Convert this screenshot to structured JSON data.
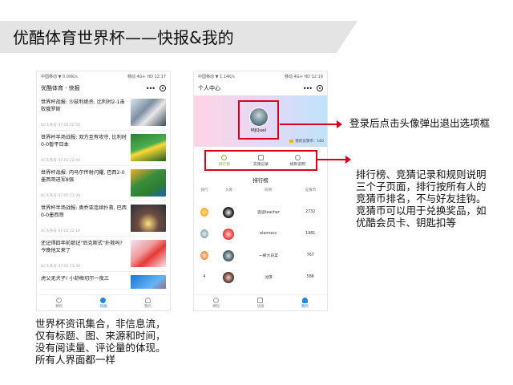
{
  "slide_title": "优酷体育世界杯——快报&我的",
  "news_phone": {
    "status_left": "中国移动 ▼  0.00K/s",
    "status_right": "移动 4G+ HD  12:17",
    "nav_title": "优酷体育 · 快报",
    "more_icon": "more-dots-icon",
    "target_icon": "target-circle-icon",
    "items": [
      {
        "title": "世界杯战报: 沙兹利绝杀, 比利时2-1击败俄罗斯",
        "meta": "UC头条号  07-03 22:50",
        "thumb": "photo-thumbnail"
      },
      {
        "title": "世界杯半场战报: 双方互有攻守, 比利时0-0暂平日本",
        "meta": "UC头条号  07-03 22:40",
        "thumb": "photo-thumbnail"
      },
      {
        "title": "世界杯战报: 内马尔传射闪耀, 巴西2-0墨西哥进军8强",
        "meta": "UC头条号  07-02 23:30",
        "thumb": "photo-thumbnail"
      },
      {
        "title": "世界杯半场战报: 奥乔亚连续扑救, 巴西0-0墨西哥",
        "meta": "UC头条号  07-02 22:10",
        "thumb": "photo-thumbnail"
      },
      {
        "title": "还记得四年前那记\"后克斯式\"扑救吗? 今晚他又来了",
        "meta": "UC头条号  07-02 21:30",
        "thumb": "photo-thumbnail"
      },
      {
        "title": "虎父无犬子! 小舒梅切尔一夜三",
        "meta": "",
        "thumb": "photo-thumbnail"
      }
    ],
    "tabs": [
      {
        "label": "赛程",
        "icon": "trophy-icon"
      },
      {
        "label": "快报",
        "icon": "news-icon"
      },
      {
        "label": "我的",
        "icon": "profile-icon"
      }
    ]
  },
  "profile_phone": {
    "status_left": "中国移动 ▼  1.14K/s",
    "status_right": "移动 4G+ HD  12:19",
    "nav_title": "个人中心",
    "user_name": "MJQuel",
    "coins_label": "我的竞猜币：160",
    "subtabs": [
      {
        "label": "排行榜",
        "icon": "trophy-icon"
      },
      {
        "label": "竞猜记录",
        "icon": "record-icon"
      },
      {
        "label": "规则说明",
        "icon": "question-icon"
      }
    ],
    "rank_title": "排行榜",
    "rank_columns": [
      "排行",
      "头像",
      "昵称",
      "竞猜币"
    ],
    "rows": [
      {
        "rank": "",
        "name": "道道teacher",
        "coins": "2732"
      },
      {
        "rank": "",
        "name": "elannecc",
        "coins": "1981"
      },
      {
        "rank": "",
        "name": "一梯大白菜",
        "coins": "767"
      },
      {
        "rank": "4",
        "name": "沈琪",
        "coins": "588"
      }
    ],
    "tabs": [
      {
        "label": "赛程",
        "icon": "trophy-icon"
      },
      {
        "label": "快报",
        "icon": "news-icon"
      },
      {
        "label": "我的",
        "icon": "profile-icon"
      }
    ]
  },
  "annotations": {
    "avatar_note": "登录后点击头像弹出退出选项框",
    "tabs_note": "排行榜、竞猜记录和规则说明三个子页面，排行按所有人的竞猜币排名，不与好友挂钩。竞猜币可以用于兑换奖品，如优酷会员卡、钥匙扣等",
    "news_note": "世界杯资讯集合，非信息流，仅有标题、图、来源和时间，没有阅读量、评论量的体现。所有人界面都一样"
  },
  "colors": {
    "highlight": "#d9001b",
    "tab_active": "#1e88e5",
    "subtab_active": "#7cb342"
  }
}
